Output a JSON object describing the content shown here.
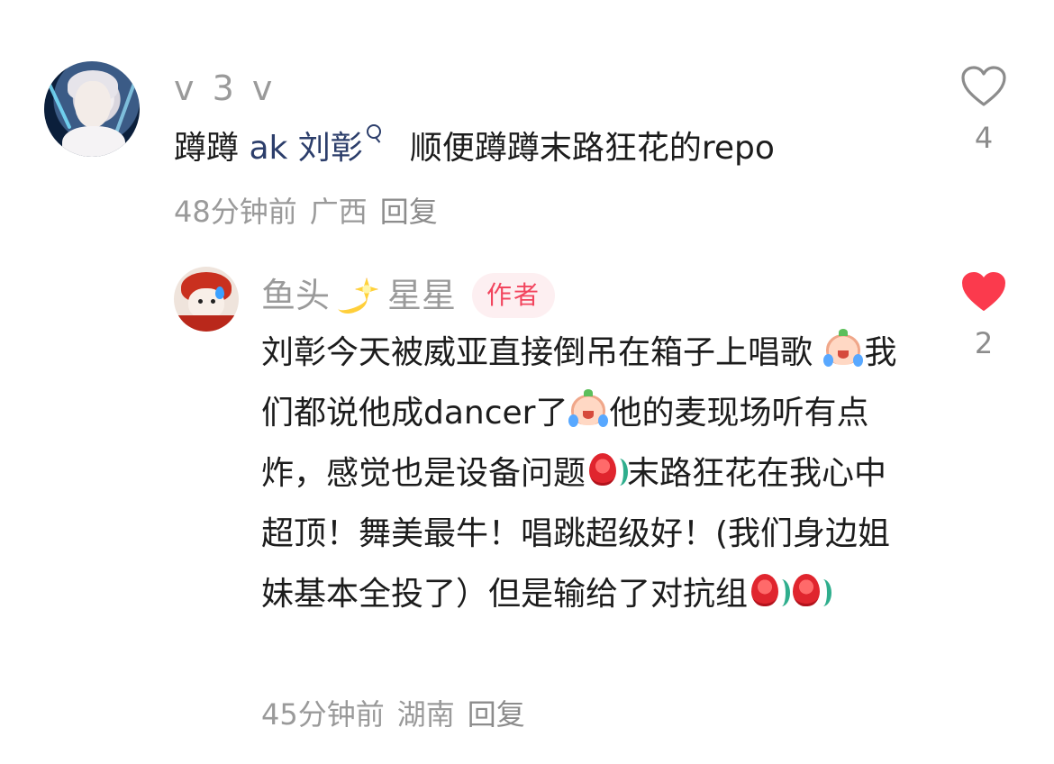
{
  "comments": [
    {
      "username": "v 3 v",
      "text_prefix": "蹲蹲 ",
      "mention": "ak 刘彰",
      "text_suffix": "顺便蹲蹲末路狂花的repo",
      "time": "48分钟前",
      "location": "广西",
      "reply_label": "回复",
      "like_count": "4",
      "liked": false
    },
    {
      "username_part1": "鱼头",
      "username_part2": "星星",
      "author_badge": "作者",
      "text_1": "刘彰今天被威亚直接倒吊在箱子上唱歌",
      "text_2": "我们都说他成dancer了",
      "text_3": "他的麦现场听有点炸，感觉也是设备问题",
      "text_4": "末路狂花在我心中超顶！舞美最牛！唱跳超级好！(我们身边姐妹基本全投了）但是输给了对抗组",
      "time": "45分钟前",
      "location": "湖南",
      "reply_label": "回复",
      "like_count": "2",
      "liked": true
    }
  ],
  "colors": {
    "liked_heart": "#fb3a4d",
    "badge_text": "#f2455e",
    "badge_bg": "#fdeff1",
    "mention": "#2c3e6b",
    "meta": "#9a9a9a"
  },
  "icons": [
    "heart-outline-icon",
    "heart-filled-icon",
    "search-mention-icon",
    "sparkle-emoji-icon",
    "crying-emoji-icon",
    "rose-emoji-icon"
  ]
}
